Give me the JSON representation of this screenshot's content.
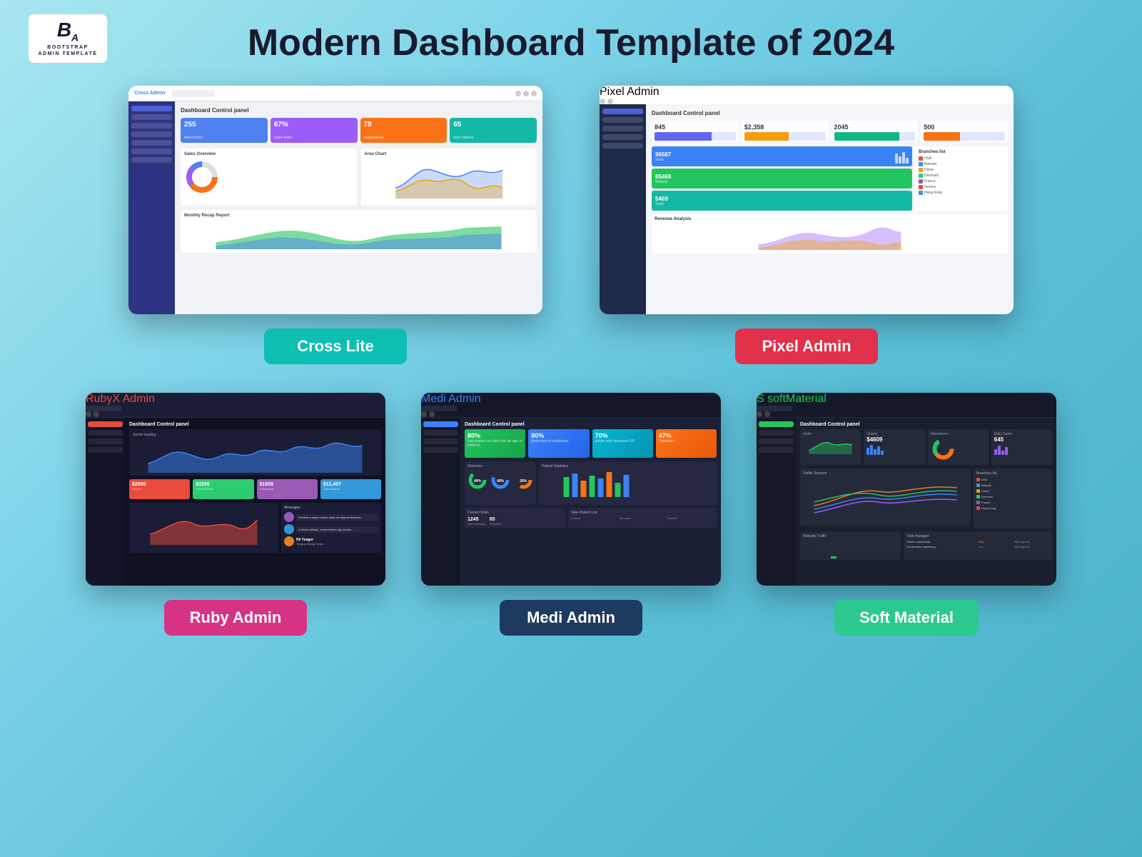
{
  "header": {
    "title": "Modern Dashboard Template of 2024",
    "logo": {
      "icon": "Bₐ",
      "text": "BOOTSTRAP\nADMIN TEMPLATE"
    }
  },
  "templates": {
    "top": [
      {
        "id": "cross-lite",
        "label": "Cross Lite",
        "badge_color": "badge-teal",
        "stats": [
          "255",
          "67%",
          "78",
          "65"
        ],
        "stat_labels": [
          "New Orders",
          "Sales Ratio",
          "Negotiations",
          "New Visitors"
        ]
      },
      {
        "id": "pixel-admin",
        "label": "Pixel Admin",
        "badge_color": "badge-crimson",
        "stats": [
          "845",
          "$2,358",
          "2045",
          "500"
        ]
      }
    ],
    "bottom": [
      {
        "id": "ruby-admin",
        "label": "Ruby Admin",
        "badge_color": "badge-magenta",
        "stats": [
          "$2550",
          "$3200",
          "$1658",
          "$12,457"
        ]
      },
      {
        "id": "medi-admin",
        "label": "Medi Admin",
        "badge_color": "badge-navy",
        "stats": [
          "80%",
          "80%",
          "70%",
          "47%"
        ]
      },
      {
        "id": "soft-material",
        "label": "Soft Material",
        "badge_color": "badge-green",
        "stats": [
          "Visits",
          "Orders",
          "Advertisers",
          "Daily Sales"
        ]
      }
    ]
  }
}
